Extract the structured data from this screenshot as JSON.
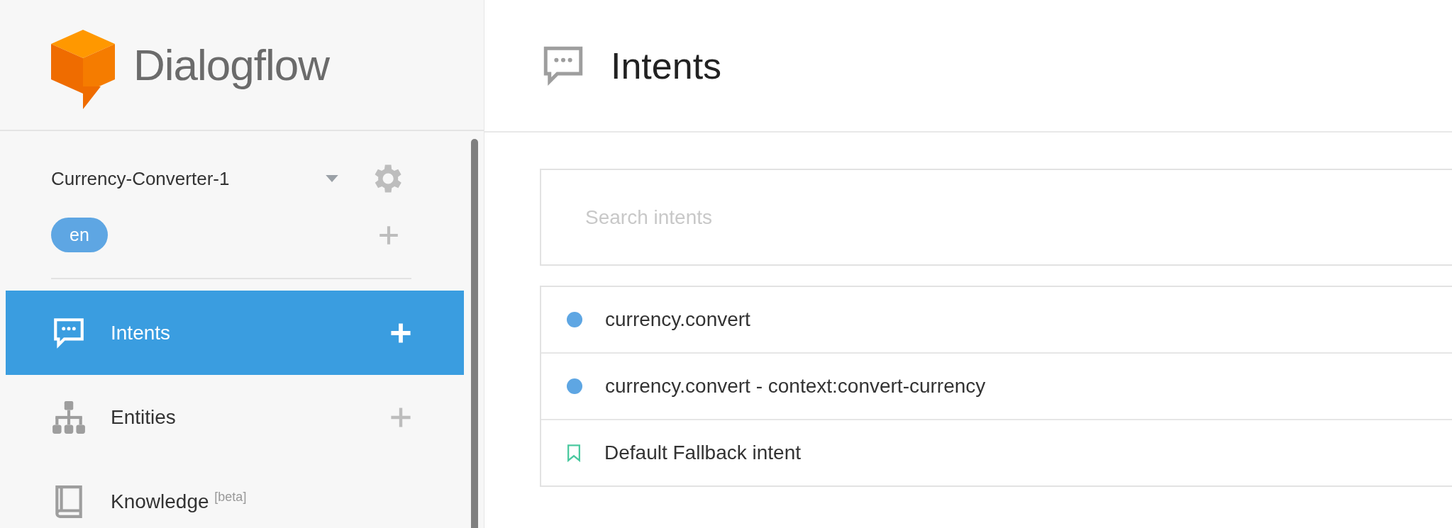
{
  "brand": {
    "name": "Dialogflow"
  },
  "agent": {
    "name": "Currency-Converter-1",
    "language": "en"
  },
  "sidebar": {
    "items": [
      {
        "kind": "intents",
        "label": "Intents",
        "selected": true,
        "addable": true
      },
      {
        "kind": "entities",
        "label": "Entities",
        "selected": false,
        "addable": true
      },
      {
        "kind": "knowledge",
        "label": "Knowledge $^{[beta]}$",
        "selected": false,
        "addable": false
      }
    ]
  },
  "page": {
    "title": "Intents"
  },
  "search": {
    "placeholder": "Search intents"
  },
  "intents": [
    {
      "kind": "regular",
      "name": "currency.convert"
    },
    {
      "kind": "regular",
      "name": "currency.convert - context:convert-currency"
    },
    {
      "kind": "fallback",
      "name": "Default Fallback intent"
    }
  ]
}
